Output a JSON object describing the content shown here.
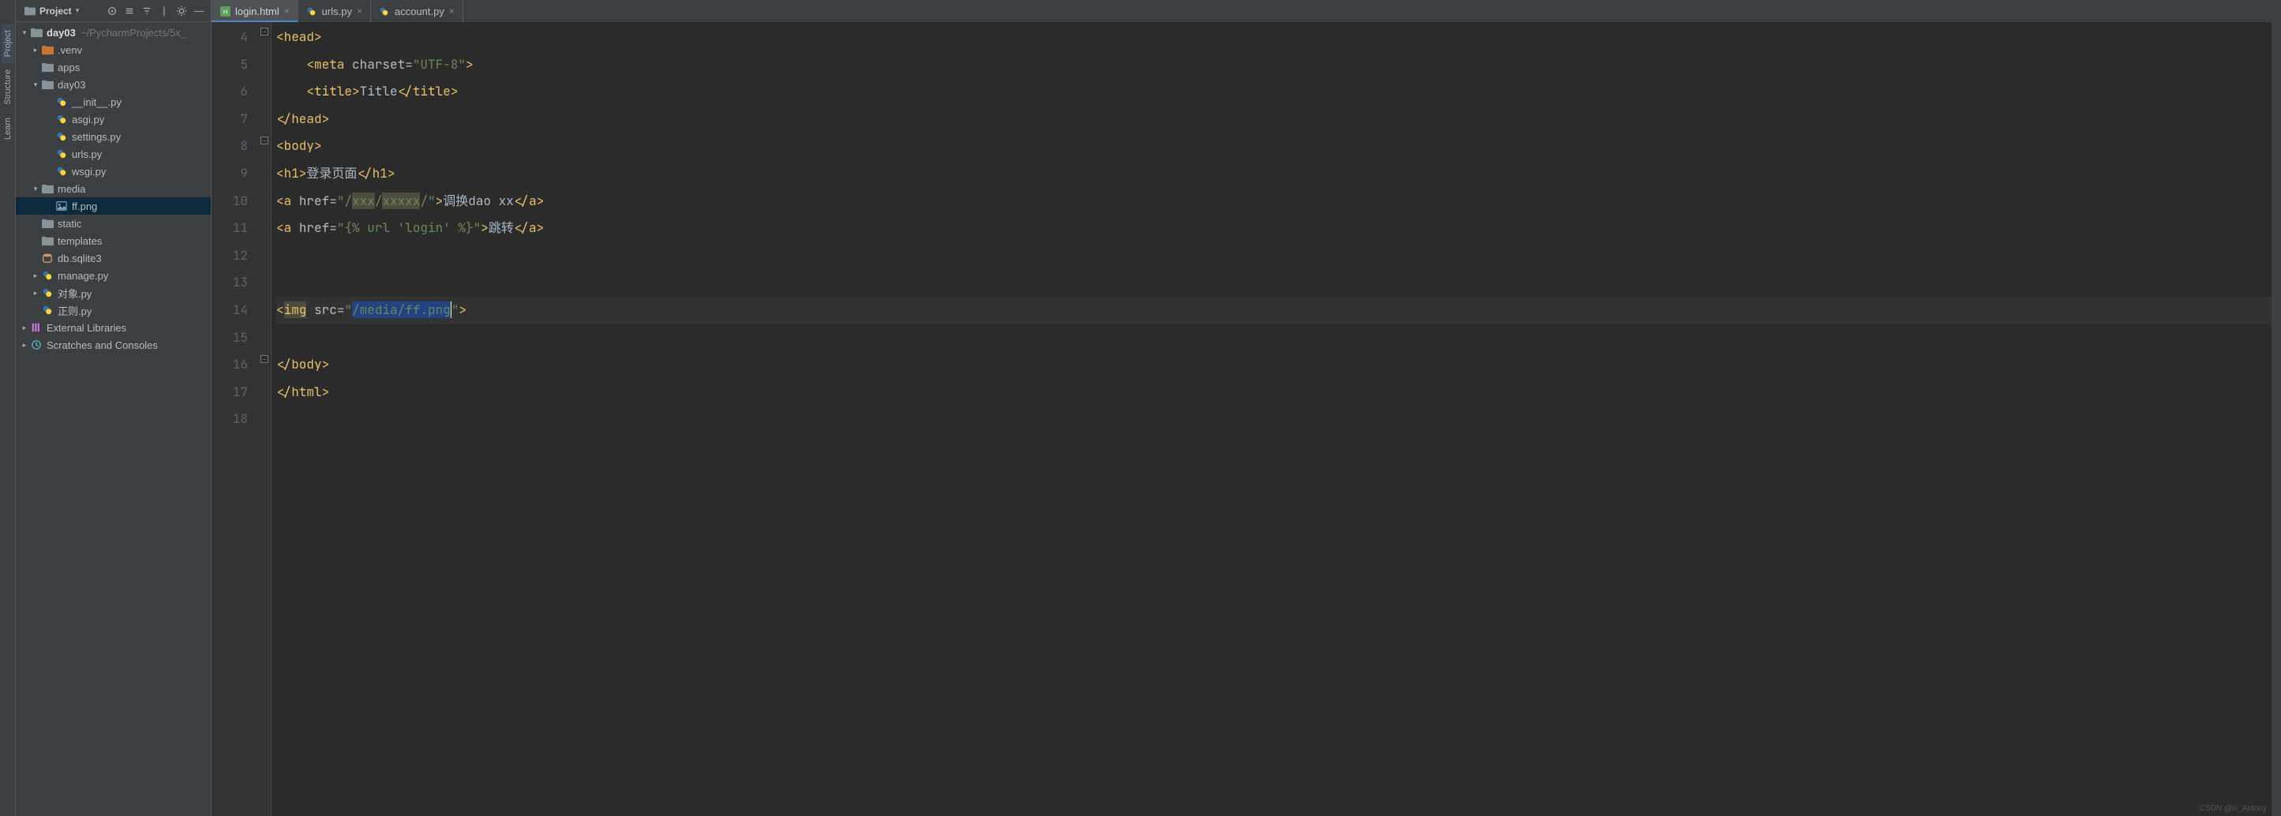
{
  "rail": {
    "project": "Project",
    "structure": "Structure",
    "learn": "Learn"
  },
  "panel": {
    "combo": "Project",
    "root": {
      "name": "day03",
      "path": "~/PycharmProjects/5x_"
    },
    "tree": {
      "venv": ".venv",
      "apps": "apps",
      "day03": "day03",
      "init": "__init__.py",
      "asgi": "asgi.py",
      "settings": "settings.py",
      "urls": "urls.py",
      "wsgi": "wsgi.py",
      "media": "media",
      "ffpng": "ff.png",
      "static": "static",
      "templates": "templates",
      "db": "db.sqlite3",
      "manage": "manage.py",
      "duixiang": "对象.py",
      "zhengze": "正则.py",
      "extlib": "External Libraries",
      "scratch": "Scratches and Consoles"
    }
  },
  "tabs": [
    {
      "label": "login.html",
      "type": "html",
      "active": true
    },
    {
      "label": "urls.py",
      "type": "py",
      "active": false
    },
    {
      "label": "account.py",
      "type": "py",
      "active": false
    }
  ],
  "gutter": {
    "start": 4,
    "end": 18
  },
  "code": {
    "l4": {
      "open": "<head>"
    },
    "l5": {
      "open": "<meta ",
      "attr": "charset=",
      "str": "\"UTF-8\"",
      "close": ">"
    },
    "l6": {
      "open": "<title>",
      "text": "Title",
      "close": "</title>"
    },
    "l7": {
      "close": "</head>"
    },
    "l8": {
      "open": "<body>"
    },
    "l9": {
      "open": "<h1>",
      "text": "登录页面",
      "close": "</h1>"
    },
    "l10": {
      "open": "<a ",
      "attr": "href=",
      "q1": "\"/",
      "hl1": "xxx",
      "mid": "/",
      "hl2": "xxxxx",
      "q2": "/\"",
      "brk": ">",
      "text": "调换dao xx",
      "close": "</a>"
    },
    "l11": {
      "open": "<a ",
      "attr": "href=",
      "str": "\"{% url 'login' %}\"",
      "brk": ">",
      "text": "跳转",
      "close": "</a>"
    },
    "l14": {
      "open": "<",
      "tagHl": "img",
      "sp": " ",
      "attr": "src=",
      "q1": "\"",
      "sel": "/media/ff.png",
      "q2": "\"",
      "close": ">"
    },
    "l16": {
      "close": "</body>"
    },
    "l17": {
      "close": "</html>"
    }
  },
  "watermark": "CSDN @is_Antony"
}
